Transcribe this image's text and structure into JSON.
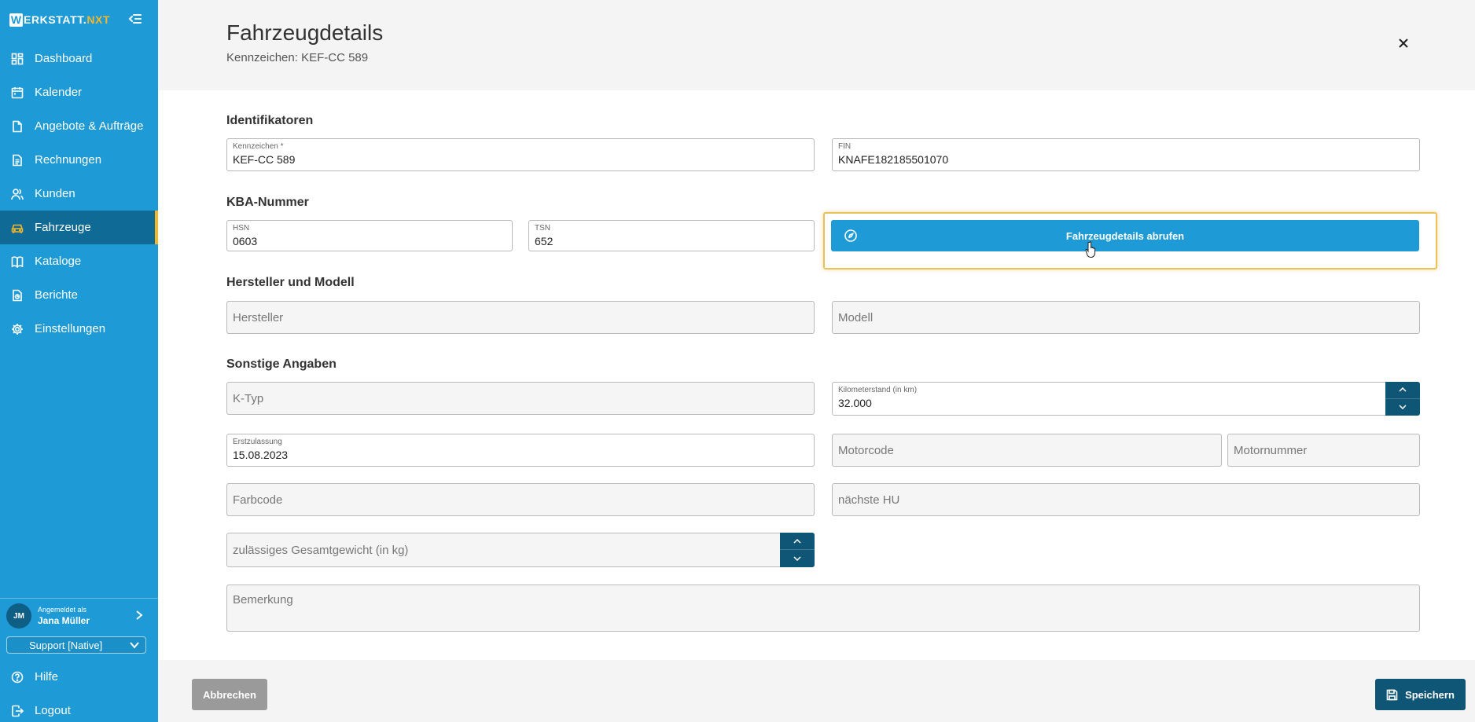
{
  "app": {
    "logo_letter": "W",
    "logo_main": "ERKSTATT.",
    "logo_accent": "NXT",
    "brand_color": "#1e9ad6",
    "accent_color": "#f5b72a",
    "dark_color": "#0f5676"
  },
  "sidebar": {
    "items": [
      {
        "label": "Dashboard",
        "icon": "dashboard-icon"
      },
      {
        "label": "Kalender",
        "icon": "calendar-icon"
      },
      {
        "label": "Angebote & Aufträge",
        "icon": "document-icon"
      },
      {
        "label": "Rechnungen",
        "icon": "invoice-icon"
      },
      {
        "label": "Kunden",
        "icon": "customers-icon"
      },
      {
        "label": "Fahrzeuge",
        "icon": "car-icon",
        "active": true
      },
      {
        "label": "Kataloge",
        "icon": "book-icon"
      },
      {
        "label": "Berichte",
        "icon": "report-icon"
      },
      {
        "label": "Einstellungen",
        "icon": "gear-icon"
      }
    ],
    "user": {
      "initials": "JM",
      "logged_in_label": "Angemeldet als",
      "name": "Jana Müller"
    },
    "support_select": "Support [Native]",
    "bottom_items": [
      {
        "label": "Hilfe",
        "icon": "help-icon"
      },
      {
        "label": "Logout",
        "icon": "logout-icon"
      }
    ]
  },
  "header": {
    "title": "Fahrzeugdetails",
    "subtitle": "Kennzeichen: KEF-CC 589"
  },
  "form": {
    "sections": {
      "identifiers": "Identifikatoren",
      "kba": "KBA-Nummer",
      "manufacturer": "Hersteller und Modell",
      "other": "Sonstige Angaben"
    },
    "kennzeichen": {
      "label": "Kennzeichen *",
      "value": "KEF-CC 589"
    },
    "fin": {
      "label": "FIN",
      "value": "KNAFE182185501070"
    },
    "hsn": {
      "label": "HSN",
      "value": "0603"
    },
    "tsn": {
      "label": "TSN",
      "value": "652"
    },
    "fetch_button": "Fahrzeugdetails abrufen",
    "hersteller": {
      "placeholder": "Hersteller"
    },
    "modell": {
      "placeholder": "Modell"
    },
    "ktyp": {
      "placeholder": "K-Typ"
    },
    "kilometerstand": {
      "label": "Kilometerstand (in km)",
      "value": "32.000"
    },
    "erstzulassung": {
      "label": "Erstzulassung",
      "value": "15.08.2023"
    },
    "motorcode": {
      "placeholder": "Motorcode"
    },
    "motornummer": {
      "placeholder": "Motornummer"
    },
    "farbcode": {
      "placeholder": "Farbcode"
    },
    "naechste_hu": {
      "placeholder": "nächste HU"
    },
    "gesamtgewicht": {
      "placeholder": "zulässiges Gesamtgewicht (in kg)"
    },
    "bemerkung": {
      "placeholder": "Bemerkung"
    }
  },
  "footer": {
    "cancel_label": "Abbrechen",
    "save_label": "Speichern"
  }
}
